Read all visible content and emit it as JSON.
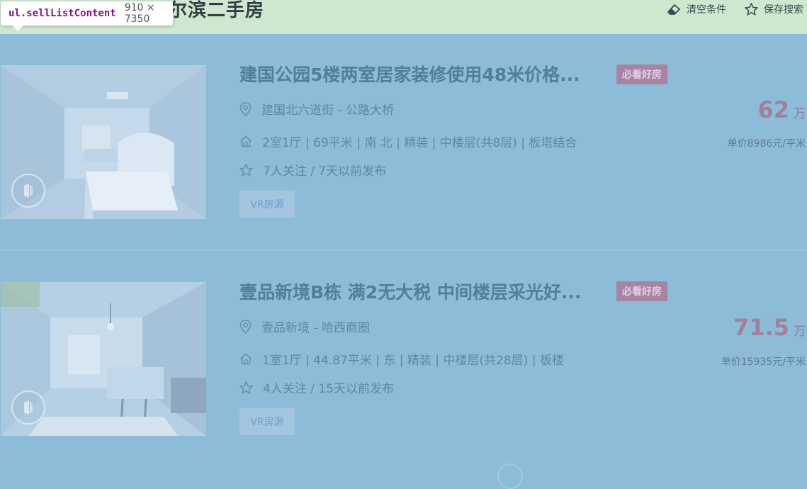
{
  "page": {
    "title": "尔滨二手房"
  },
  "topbar": {
    "clear_label": "清空条件",
    "save_search_label": "保存搜索"
  },
  "tooltip": {
    "selector": "ul.sellListContent",
    "dimensions": "910 × 7350"
  },
  "listings": [
    {
      "title": "建国公园5楼两室居家装修使用48米价格...",
      "tag": "必看好房",
      "location": "建国北六道街 - 公路大桥",
      "house_info": "2室1厅 | 69平米 | 南 北 | 精装 | 中楼层(共8层) | 板塔结合",
      "follow_info": "7人关注 / 7天以前发布",
      "vr_button": "VR房源",
      "price": "62",
      "price_unit": "万",
      "unit_price": "单价8986元/平米"
    },
    {
      "title": "壹品新境B栋 满2无大税 中间楼层采光好...",
      "tag": "必看好房",
      "location": "壹品新境 - 哈西商圈",
      "house_info": "1室1厅 | 44.87平米 | 东 | 精装 | 中楼层(共28层) | 板楼",
      "follow_info": "4人关注 / 15天以前发布",
      "vr_button": "VR房源",
      "price": "71.5",
      "price_unit": "万",
      "unit_price": "单价15935元/平米"
    }
  ],
  "colors": {
    "overlay": "#8dbcd8",
    "topbar": "#cfe7cf",
    "title": "#537e99",
    "tag": "#a685a3",
    "price": "#a0819c"
  }
}
